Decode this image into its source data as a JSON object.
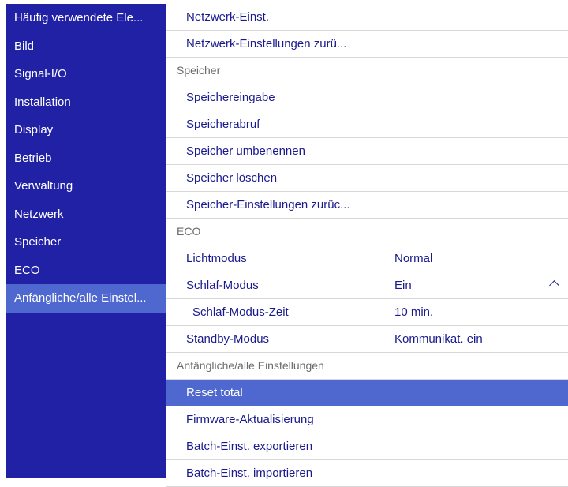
{
  "sidebar": {
    "items": [
      {
        "label": "Häufig verwendete Ele..."
      },
      {
        "label": "Bild"
      },
      {
        "label": "Signal-I/O"
      },
      {
        "label": "Installation"
      },
      {
        "label": "Display"
      },
      {
        "label": "Betrieb"
      },
      {
        "label": "Verwaltung"
      },
      {
        "label": "Netzwerk"
      },
      {
        "label": "Speicher"
      },
      {
        "label": "ECO"
      },
      {
        "label": "Anfängliche/alle Einstel...",
        "active": true
      }
    ]
  },
  "panel": {
    "rows": [
      {
        "label": "Netzwerk-Einst."
      },
      {
        "label": "Netzwerk-Einstellungen zurü..."
      },
      {
        "label": "Speicher",
        "section": true
      },
      {
        "label": "Speichereingabe"
      },
      {
        "label": "Speicherabruf"
      },
      {
        "label": "Speicher umbenennen"
      },
      {
        "label": "Speicher löschen"
      },
      {
        "label": "Speicher-Einstellungen zurüc..."
      },
      {
        "label": "ECO",
        "section": true
      },
      {
        "label": "Lichtmodus",
        "value": "Normal"
      },
      {
        "label": "Schlaf-Modus",
        "value": "Ein",
        "icon": "chevron-up-icon"
      },
      {
        "label": "Schlaf-Modus-Zeit",
        "value": "10 min.",
        "indent": true
      },
      {
        "label": "Standby-Modus",
        "value": "Kommunikat. ein"
      },
      {
        "label": "Anfängliche/alle Einstellungen",
        "section": true
      },
      {
        "label": "Reset total",
        "selected": true
      },
      {
        "label": "Firmware-Aktualisierung"
      },
      {
        "label": "Batch-Einst. exportieren"
      },
      {
        "label": "Batch-Einst. importieren"
      }
    ]
  },
  "colors": {
    "sidebar_bg": "#2121a6",
    "highlight": "#4e68cf",
    "text": "#1a1a8e",
    "section_text": "#6b6b6b",
    "divider": "#d8d8d8"
  }
}
